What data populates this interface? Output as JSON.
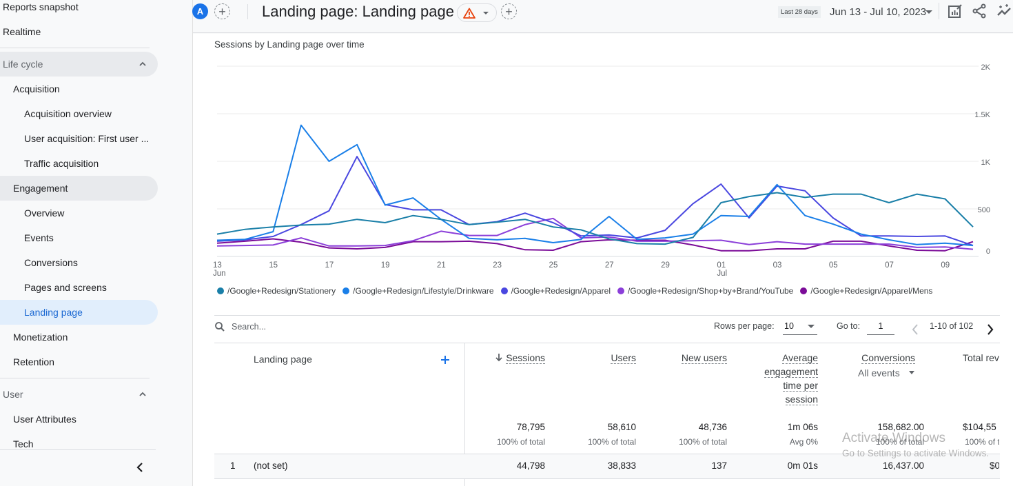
{
  "sidebar": {
    "items": [
      {
        "label": "Reports snapshot",
        "level": 0
      },
      {
        "label": "Realtime",
        "level": 0
      },
      {
        "label": "Life cycle",
        "level": "section"
      },
      {
        "label": "Acquisition",
        "level": 1
      },
      {
        "label": "Acquisition overview",
        "level": 2
      },
      {
        "label": "User acquisition: First user ...",
        "level": 2
      },
      {
        "label": "Traffic acquisition",
        "level": 2
      },
      {
        "label": "Engagement",
        "level": 1
      },
      {
        "label": "Overview",
        "level": 2
      },
      {
        "label": "Events",
        "level": 2
      },
      {
        "label": "Conversions",
        "level": 2
      },
      {
        "label": "Pages and screens",
        "level": 2
      },
      {
        "label": "Landing page",
        "level": 2,
        "active": true
      },
      {
        "label": "Monetization",
        "level": 1
      },
      {
        "label": "Retention",
        "level": 1
      },
      {
        "label": "User",
        "level": "section"
      },
      {
        "label": "User Attributes",
        "level": 1
      },
      {
        "label": "Tech",
        "level": 1
      }
    ]
  },
  "header": {
    "avatar_letter": "A",
    "title": "Landing page: Landing page",
    "date_badge": "Last 28 days",
    "date_range": "Jun 13 - Jul 10, 2023"
  },
  "chart_data": {
    "type": "line",
    "title": "Sessions by Landing page over time",
    "xlabel": "",
    "ylabel": "Sessions",
    "ylim": [
      0,
      2000
    ],
    "y_ticks": [
      "0",
      "500",
      "1K",
      "1.5K",
      "2K"
    ],
    "y_axis_side": "right",
    "grid": true,
    "legend_position": "bottom",
    "x": [
      "Jun 13",
      "Jun 14",
      "Jun 15",
      "Jun 16",
      "Jun 17",
      "Jun 18",
      "Jun 19",
      "Jun 20",
      "Jun 21",
      "Jun 22",
      "Jun 23",
      "Jun 24",
      "Jun 25",
      "Jun 26",
      "Jun 27",
      "Jun 28",
      "Jun 29",
      "Jun 30",
      "Jul 01",
      "Jul 02",
      "Jul 03",
      "Jul 04",
      "Jul 05",
      "Jul 06",
      "Jul 07",
      "Jul 08",
      "Jul 09",
      "Jul 10"
    ],
    "x_tick_labels": [
      {
        "label": "13",
        "sub": "Jun",
        "index": 0
      },
      {
        "label": "15",
        "index": 2
      },
      {
        "label": "17",
        "index": 4
      },
      {
        "label": "19",
        "index": 6
      },
      {
        "label": "21",
        "index": 8
      },
      {
        "label": "23",
        "index": 10
      },
      {
        "label": "25",
        "index": 12
      },
      {
        "label": "27",
        "index": 14
      },
      {
        "label": "29",
        "index": 16
      },
      {
        "label": "01",
        "sub": "Jul",
        "index": 18
      },
      {
        "label": "03",
        "index": 20
      },
      {
        "label": "05",
        "index": 22
      },
      {
        "label": "07",
        "index": 24
      },
      {
        "label": "09",
        "index": 26
      }
    ],
    "series": [
      {
        "name": "/Google+Redesign/Stationery",
        "color": "#1a7fa8",
        "values": [
          235,
          285,
          310,
          330,
          340,
          390,
          355,
          430,
          390,
          335,
          360,
          390,
          310,
          280,
          185,
          135,
          130,
          200,
          565,
          630,
          670,
          620,
          655,
          655,
          565,
          655,
          605,
          310
        ]
      },
      {
        "name": "/Google+Redesign/Lifestyle/Drinkware",
        "color": "#1a7fe8",
        "values": [
          170,
          180,
          260,
          1380,
          1000,
          1175,
          540,
          615,
          390,
          190,
          175,
          190,
          145,
          180,
          420,
          180,
          195,
          235,
          430,
          420,
          755,
          430,
          340,
          235,
          175,
          125,
          140,
          115
        ]
      },
      {
        "name": "/Google+Redesign/Apparel",
        "color": "#4a47e0",
        "values": [
          160,
          175,
          210,
          335,
          480,
          1050,
          545,
          490,
          490,
          335,
          365,
          455,
          355,
          215,
          225,
          195,
          275,
          555,
          760,
          405,
          740,
          690,
          405,
          215,
          215,
          210,
          215,
          115
        ]
      },
      {
        "name": "/Google+Redesign/Shop+by+Brand/YouTube",
        "color": "#8b3fd9",
        "values": [
          110,
          115,
          120,
          195,
          110,
          110,
          115,
          165,
          265,
          220,
          220,
          335,
          400,
          195,
          205,
          160,
          160,
          165,
          170,
          125,
          155,
          130,
          130,
          130,
          130,
          95,
          100,
          75
        ]
      },
      {
        "name": "/Google+Redesign/Apparel/Mens",
        "color": "#7b0c98",
        "values": [
          140,
          160,
          185,
          150,
          90,
          80,
          95,
          155,
          155,
          160,
          135,
          70,
          65,
          155,
          175,
          170,
          170,
          120,
          60,
          60,
          80,
          80,
          160,
          160,
          110,
          65,
          60,
          155
        ]
      }
    ]
  },
  "table": {
    "search_placeholder": "Search...",
    "rows_per_page_label": "Rows per page:",
    "rows_per_page_value": "10",
    "goto_label": "Go to:",
    "goto_value": "1",
    "range_text": "1-10 of 102",
    "dimension_header": "Landing page",
    "columns": [
      {
        "label": "Sessions",
        "sorted": "desc",
        "total": "78,795",
        "total_sub": "100% of total"
      },
      {
        "label": "Users",
        "total": "58,610",
        "total_sub": "100% of total"
      },
      {
        "label": "New users",
        "total": "48,736",
        "total_sub": "100% of total"
      },
      {
        "label_lines": [
          "Average",
          "engagement",
          "time per",
          "session"
        ],
        "total": "1m 06s",
        "total_sub": "Avg 0%"
      },
      {
        "label": "Conversions",
        "filter": "All events",
        "total": "158,682.00",
        "total_sub": "100% of total"
      },
      {
        "label": "Total rev",
        "total": "$104,55",
        "total_sub": "100% of t"
      }
    ],
    "rows": [
      {
        "index": "1",
        "dimension": "(not set)",
        "values": [
          "44,798",
          "38,833",
          "137",
          "0m 01s",
          "16,437.00",
          "$0"
        ]
      }
    ]
  },
  "watermark": {
    "line1": "Activate Windows",
    "line2": "Go to Settings to activate Windows."
  }
}
